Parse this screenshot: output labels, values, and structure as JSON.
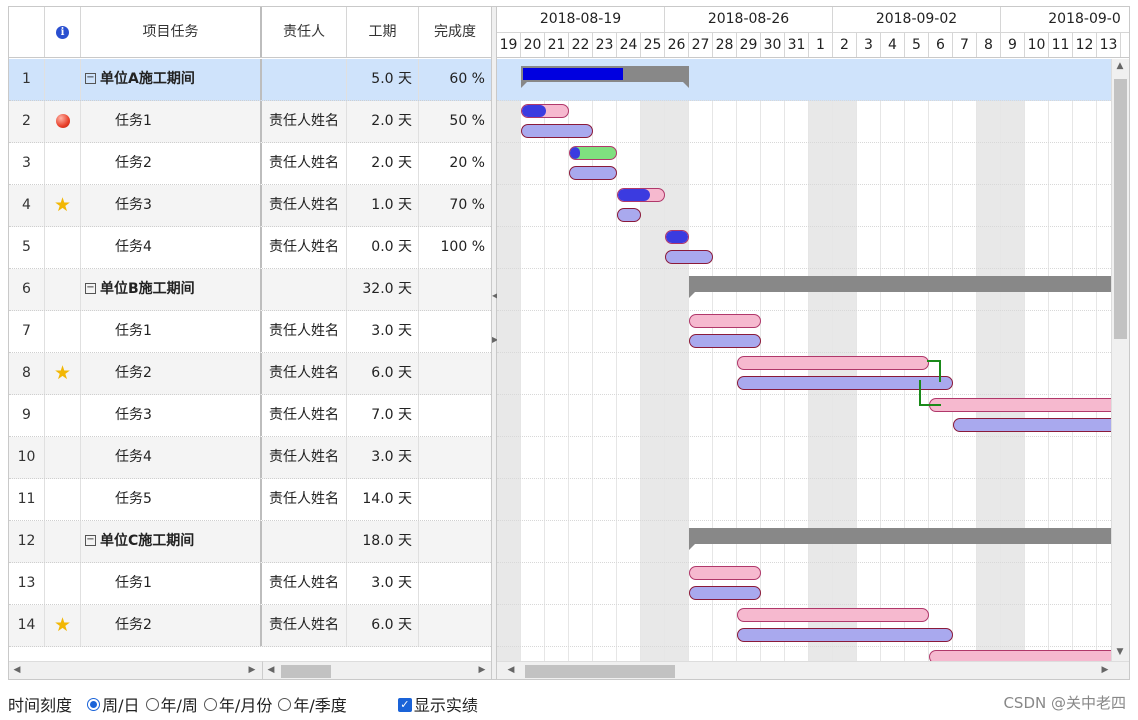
{
  "columns": {
    "num": "",
    "task": "项目任务",
    "owner": "责任人",
    "duration": "工期",
    "percent": "完成度"
  },
  "weeks": [
    "2018-08-19",
    "2018-08-26",
    "2018-09-02",
    "2018-09-0"
  ],
  "days": [
    "19",
    "20",
    "21",
    "22",
    "23",
    "24",
    "25",
    "26",
    "27",
    "28",
    "29",
    "30",
    "31",
    "1",
    "2",
    "3",
    "4",
    "5",
    "6",
    "7",
    "8",
    "9",
    "10",
    "11",
    "12",
    "13"
  ],
  "rows": [
    {
      "num": "1",
      "icon": "",
      "task": "单位A施工期间",
      "group": true,
      "owner": "",
      "duration": "5.0 天",
      "percent": "60 %"
    },
    {
      "num": "2",
      "icon": "red-dot",
      "task": "任务1",
      "group": false,
      "owner": "责任人姓名",
      "duration": "2.0 天",
      "percent": "50 %"
    },
    {
      "num": "3",
      "icon": "",
      "task": "任务2",
      "group": false,
      "owner": "责任人姓名",
      "duration": "2.0 天",
      "percent": "20 %"
    },
    {
      "num": "4",
      "icon": "star",
      "task": "任务3",
      "group": false,
      "owner": "责任人姓名",
      "duration": "1.0 天",
      "percent": "70 %"
    },
    {
      "num": "5",
      "icon": "",
      "task": "任务4",
      "group": false,
      "owner": "责任人姓名",
      "duration": "0.0 天",
      "percent": "100 %"
    },
    {
      "num": "6",
      "icon": "",
      "task": "单位B施工期间",
      "group": true,
      "owner": "",
      "duration": "32.0 天",
      "percent": ""
    },
    {
      "num": "7",
      "icon": "",
      "task": "任务1",
      "group": false,
      "owner": "责任人姓名",
      "duration": "3.0 天",
      "percent": ""
    },
    {
      "num": "8",
      "icon": "star",
      "task": "任务2",
      "group": false,
      "owner": "责任人姓名",
      "duration": "6.0 天",
      "percent": ""
    },
    {
      "num": "9",
      "icon": "",
      "task": "任务3",
      "group": false,
      "owner": "责任人姓名",
      "duration": "7.0 天",
      "percent": ""
    },
    {
      "num": "10",
      "icon": "",
      "task": "任务4",
      "group": false,
      "owner": "责任人姓名",
      "duration": "3.0 天",
      "percent": ""
    },
    {
      "num": "11",
      "icon": "",
      "task": "任务5",
      "group": false,
      "owner": "责任人姓名",
      "duration": "14.0 天",
      "percent": ""
    },
    {
      "num": "12",
      "icon": "",
      "task": "单位C施工期间",
      "group": true,
      "owner": "",
      "duration": "18.0 天",
      "percent": ""
    },
    {
      "num": "13",
      "icon": "",
      "task": "任务1",
      "group": false,
      "owner": "责任人姓名",
      "duration": "3.0 天",
      "percent": ""
    },
    {
      "num": "14",
      "icon": "star",
      "task": "任务2",
      "group": false,
      "owner": "责任人姓名",
      "duration": "6.0 天",
      "percent": ""
    }
  ],
  "footer": {
    "scale_label": "时间刻度",
    "options": [
      "周/日",
      "年/周",
      "年/月份",
      "年/季度"
    ],
    "selected_option": "周/日",
    "show_actual_label": "显示实绩",
    "show_actual_checked": true
  },
  "watermark": "CSDN @关中老四",
  "colors": {
    "selected_row": "#cfe3fb",
    "progress": "#0000e0",
    "plan_bar": "#f6b9cf",
    "actual_bar": "#a9a9ee",
    "summary_bar": "#888888",
    "link": "#1a8a1a"
  }
}
